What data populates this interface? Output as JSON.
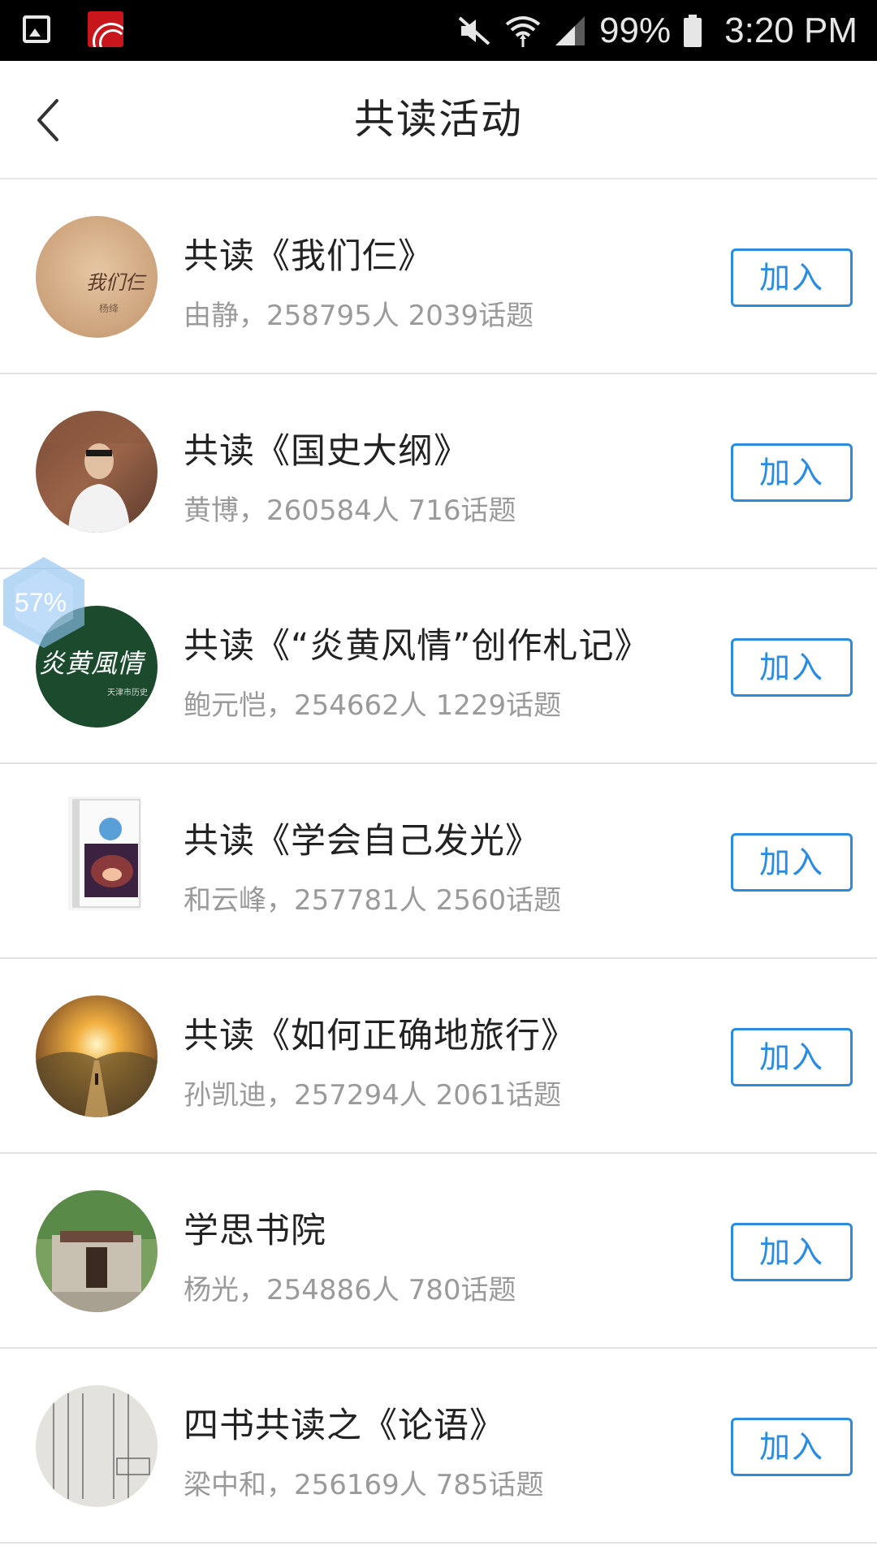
{
  "status_bar": {
    "battery_percent": "99%",
    "time": "3:20 PM",
    "icons": [
      "gallery-icon",
      "app-logo-icon",
      "mute-icon",
      "wifi-icon",
      "signal-icon",
      "battery-icon"
    ]
  },
  "header": {
    "title": "共读活动",
    "back_icon": "chevron-left-icon"
  },
  "floating_badge": {
    "label": "57%"
  },
  "items": [
    {
      "title": "共读《我们仨》",
      "meta": "由静，258795人 2039话题",
      "button": "加入",
      "cover_text": "我们仨",
      "cover_subtext": "杨绛"
    },
    {
      "title": "共读《国史大纲》",
      "meta": "黄博，260584人 716话题",
      "button": "加入"
    },
    {
      "title": "共读《“炎黄风情”创作札记》",
      "meta": "鲍元恺，254662人 1229话题",
      "button": "加入",
      "cover_text": "炎黄風情",
      "cover_subtext": "天津市历史"
    },
    {
      "title": "共读《学会自己发光》",
      "meta": "和云峰，257781人 2560话题",
      "button": "加入"
    },
    {
      "title": "共读《如何正确地旅行》",
      "meta": "孙凯迪，257294人 2061话题",
      "button": "加入"
    },
    {
      "title": "学思书院",
      "meta": "杨光，254886人 780话题",
      "button": "加入"
    },
    {
      "title": "四书共读之《论语》",
      "meta": "梁中和，256169人 785话题",
      "button": "加入"
    }
  ],
  "colors": {
    "accent": "#2b8be0",
    "title_text": "#222222",
    "meta_text": "#9a9a9a",
    "divider": "#e2e2e2",
    "status_bar_bg": "#000000"
  }
}
